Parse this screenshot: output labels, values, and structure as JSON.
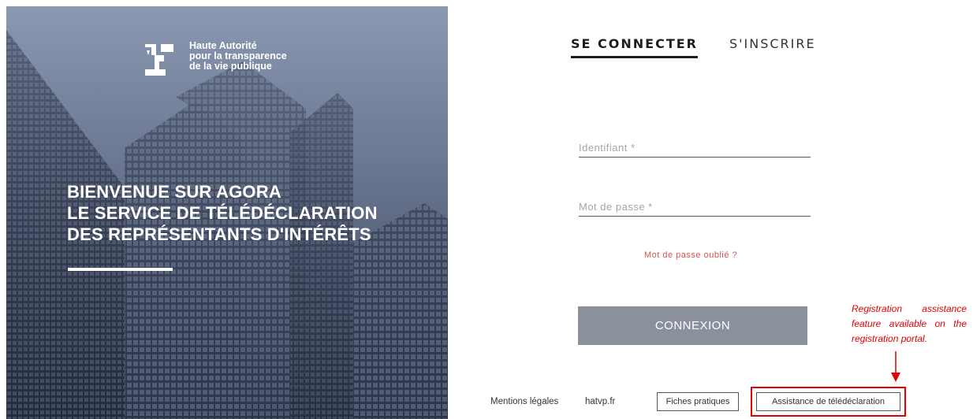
{
  "hero": {
    "logo_lines": [
      "Haute Autorité",
      "pour la transparence",
      "de la vie publique"
    ],
    "headline_lines": [
      "BIENVENUE SUR AGORA",
      "LE SERVICE DE TÉLÉDÉCLARATION",
      "DES REPRÉSENTANTS D'INTÉRÊTS"
    ]
  },
  "tabs": [
    {
      "label": "SE CONNECTER",
      "active": true
    },
    {
      "label": "S'INSCRIRE",
      "active": false
    }
  ],
  "form": {
    "identifiant_placeholder": "Identifiant *",
    "identifiant_value": "",
    "password_placeholder": "Mot de passe *",
    "password_value": "",
    "forgot_label": "Mot de passe oublié ?",
    "submit_label": "CONNEXION"
  },
  "footer": {
    "mentions": "Mentions légales",
    "site": "hatvp.fr",
    "fiches": "Fiches pratiques",
    "assistance": "Assistance de télédéclaration"
  },
  "annotation": {
    "text": "Registration assistance feature available on the registration portal."
  },
  "colors": {
    "accent_red": "#e40000",
    "forgot_link": "#d9534f",
    "submit_bg": "#8a909c"
  },
  "icons": [
    "hatvp-logo-icon",
    "arrow-down-icon"
  ]
}
